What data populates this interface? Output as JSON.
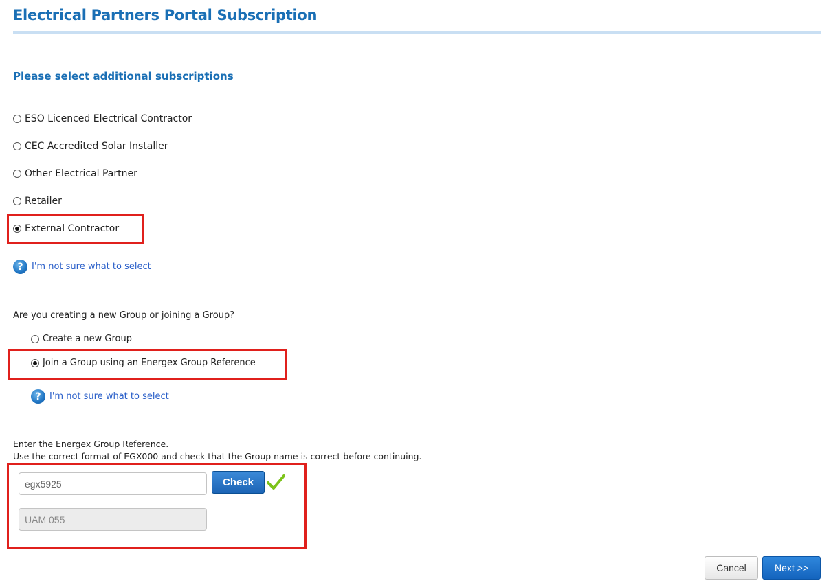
{
  "page": {
    "title": "Electrical Partners Portal Subscription"
  },
  "subscriptions": {
    "heading": "Please select additional subscriptions",
    "options": [
      {
        "label": "ESO Licenced Electrical Contractor",
        "selected": false
      },
      {
        "label": "CEC Accredited Solar Installer",
        "selected": false
      },
      {
        "label": "Other Electrical Partner",
        "selected": false
      },
      {
        "label": "Retailer",
        "selected": false
      },
      {
        "label": "External Contractor",
        "selected": true
      }
    ],
    "help_text": "I'm not sure what to select"
  },
  "group": {
    "question": "Are you creating a new Group or joining a Group?",
    "options": [
      {
        "label": "Create a new Group",
        "selected": false
      },
      {
        "label": "Join a Group using an Energex Group Reference",
        "selected": true
      }
    ],
    "help_text": "I'm not sure what to select"
  },
  "reference": {
    "instruction_line1": "Enter the Energex Group Reference.",
    "instruction_line2": "Use the correct format of EGX000 and check that the Group name is correct before continuing.",
    "input_value": "egx5925",
    "check_label": "Check",
    "check_status": "valid",
    "group_name_value": "UAM 055"
  },
  "footer": {
    "cancel_label": "Cancel",
    "next_label": "Next >>"
  },
  "icons": {
    "help": "help-icon",
    "check_ok": "checkmark-icon"
  },
  "colors": {
    "title": "#1a6fb5",
    "highlight": "#e0201c",
    "primary_button": "#1c64b5",
    "check_mark": "#7cc31a"
  }
}
